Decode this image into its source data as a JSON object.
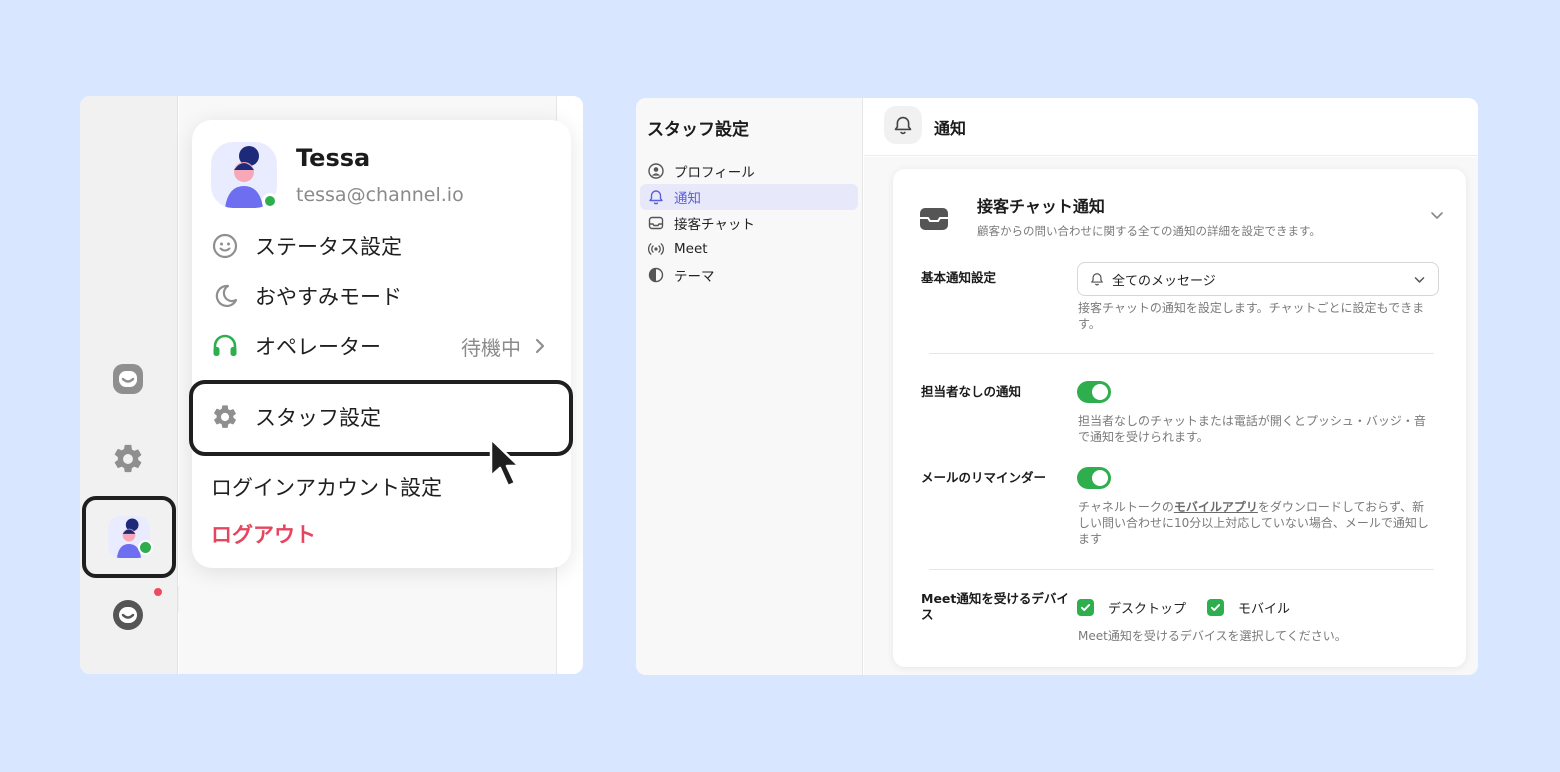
{
  "profile_menu": {
    "name": "Tessa",
    "email": "tessa@channel.io",
    "items": {
      "status": "ステータス設定",
      "sleep": "おやすみモード",
      "operator": "オペレーター",
      "operator_value": "待機中",
      "staff_settings": "スタッフ設定",
      "login_account": "ログインアカウント設定",
      "logout": "ログアウト"
    }
  },
  "settings_nav": {
    "title": "スタッフ設定",
    "items": [
      "プロフィール",
      "通知",
      "接客チャット",
      "Meet",
      "テーマ"
    ],
    "active_index": 1
  },
  "settings_header": {
    "title": "通知"
  },
  "notification_card": {
    "title": "接客チャット通知",
    "description": "顧客からの問い合わせに関する全ての通知の詳細を設定できます。",
    "basic": {
      "label": "基本通知設定",
      "selected": "全てのメッセージ",
      "help": "接客チャットの通知を設定します。チャットごとに設定もできます。"
    },
    "unassigned": {
      "label": "担当者なしの通知",
      "enabled": true,
      "help": "担当者なしのチャットまたは電話が開くとプッシュ・バッジ・音で通知を受けられます。"
    },
    "email_reminder": {
      "label": "メールのリマインダー",
      "enabled": true,
      "help_before": "チャネルトークの",
      "help_link": "モバイルアプリ",
      "help_after": "をダウンロードしておらず、新しい問い合わせに10分以上対応していない場合、メールで通知します"
    },
    "meet_devices": {
      "label": "Meet通知を受けるデバイス",
      "desktop": "デスクトップ",
      "mobile": "モバイル",
      "help": "Meet通知を受けるデバイスを選択してください。"
    }
  },
  "colors": {
    "background": "#d8e6ff",
    "online": "#2fae4e",
    "logout": "#e5465e",
    "active_nav": "#5b5fd6"
  }
}
